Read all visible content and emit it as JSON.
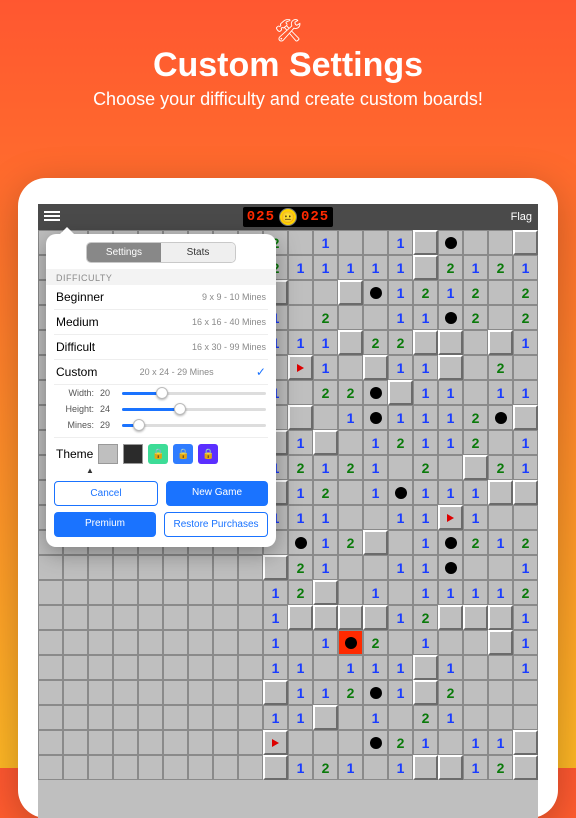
{
  "hero": {
    "icon": "🛠",
    "title": "Custom Settings",
    "subtitle": "Choose your difficulty and create custom boards!"
  },
  "topbar": {
    "mines_left": "025",
    "timer": "025",
    "flag_button": "Flag"
  },
  "popover": {
    "tabs": {
      "settings": "Settings",
      "stats": "Stats"
    },
    "section_difficulty": "DIFFICULTY",
    "levels": [
      {
        "label": "Beginner",
        "desc": "9 x 9 - 10 Mines"
      },
      {
        "label": "Medium",
        "desc": "16 x 16 - 40 Mines"
      },
      {
        "label": "Difficult",
        "desc": "16 x 30 - 99 Mines"
      },
      {
        "label": "Custom",
        "desc": "20 x 24 - 29 Mines",
        "selected": true
      }
    ],
    "sliders": {
      "width": {
        "label": "Width:",
        "value": "20",
        "pct": 28
      },
      "height": {
        "label": "Height:",
        "value": "24",
        "pct": 40
      },
      "mines": {
        "label": "Mines:",
        "value": "29",
        "pct": 12
      }
    },
    "theme_label": "Theme",
    "theme_swatches": [
      {
        "bg": "#bfbfbf"
      },
      {
        "bg": "#2b2b2b"
      }
    ],
    "theme_locked": [
      {
        "bg": "#3ddc97"
      },
      {
        "bg": "#2f7cff"
      },
      {
        "bg": "#5b2fff"
      }
    ],
    "buttons": {
      "cancel": "Cancel",
      "new_game": "New Game",
      "premium": "Premium",
      "restore": "Restore Purchases"
    }
  },
  "board_sample": {
    "note": "representative subset of visible cells",
    "numbers_seen": [
      1,
      2
    ],
    "has_mines": true,
    "has_flags": true,
    "has_hit_mine": true
  }
}
